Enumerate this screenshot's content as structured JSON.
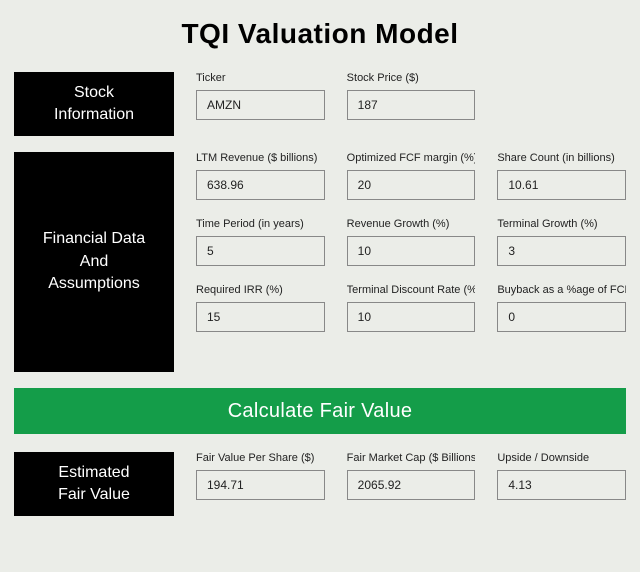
{
  "title": "TQI Valuation Model",
  "stock_info": {
    "heading": "Stock\nInformation",
    "ticker": {
      "label": "Ticker",
      "value": "AMZN"
    },
    "price": {
      "label": "Stock Price ($)",
      "value": "187"
    }
  },
  "financial": {
    "heading": "Financial Data\nAnd\nAssumptions",
    "ltm_revenue": {
      "label": "LTM Revenue ($ billions)",
      "value": "638.96"
    },
    "opt_fcf_margin": {
      "label": "Optimized FCF margin (%)",
      "value": "20"
    },
    "share_count": {
      "label": "Share Count (in billions)",
      "value": "10.61"
    },
    "time_period": {
      "label": "Time Period (in years)",
      "value": "5"
    },
    "revenue_growth": {
      "label": "Revenue Growth (%)",
      "value": "10"
    },
    "terminal_growth": {
      "label": "Terminal Growth (%)",
      "value": "3"
    },
    "required_irr": {
      "label": "Required IRR (%)",
      "value": "15"
    },
    "term_disc_rate": {
      "label": "Terminal Discount Rate (%)",
      "value": "10"
    },
    "buyback": {
      "label": "Buyback as a %age of FCF",
      "value": "0"
    }
  },
  "calculate_label": "Calculate Fair Value",
  "estimated": {
    "heading": "Estimated\nFair Value",
    "fair_value_share": {
      "label": "Fair Value Per Share ($)",
      "value": "194.71"
    },
    "fair_market_cap": {
      "label": "Fair Market Cap ($ Billions)",
      "value": "2065.92"
    },
    "upside": {
      "label": "Upside / Downside",
      "value": "4.13"
    }
  }
}
